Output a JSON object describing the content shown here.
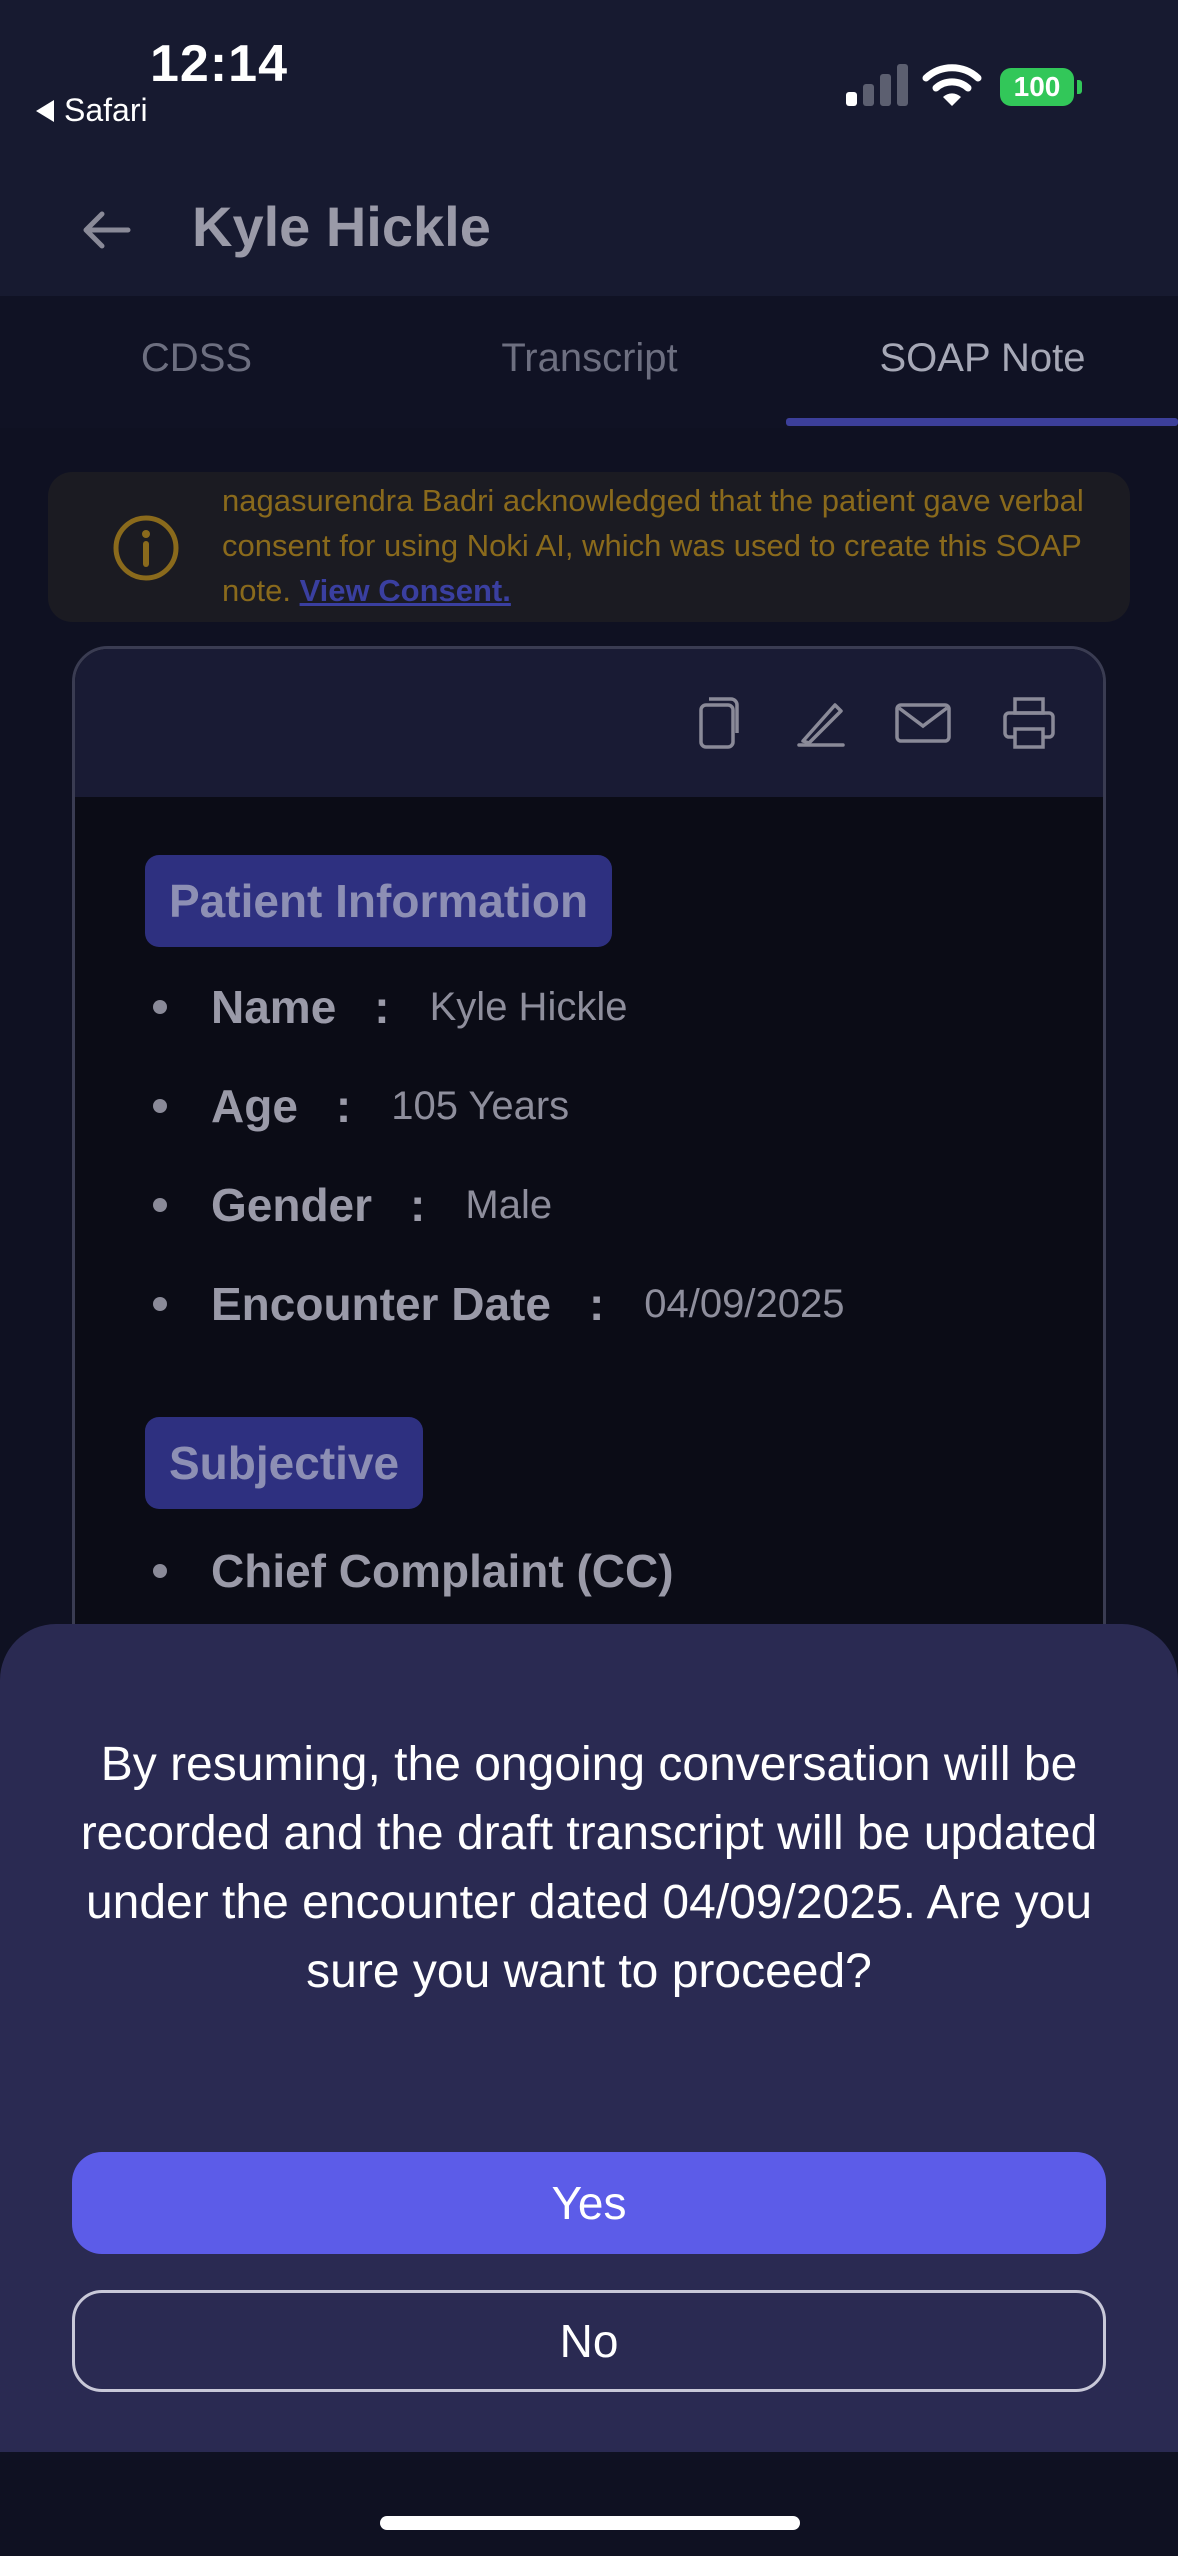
{
  "status_bar": {
    "time": "12:14",
    "back_app": "Safari",
    "battery": "100"
  },
  "header": {
    "title": "Kyle Hickle"
  },
  "tabs": [
    {
      "label": "CDSS"
    },
    {
      "label": "Transcript"
    },
    {
      "label": "SOAP Note"
    }
  ],
  "active_tab": "SOAP Note",
  "consent": {
    "text": "nagasurendra Badri acknowledged that the patient gave verbal consent for using Noki AI, which was used to create this SOAP note. ",
    "link": "View Consent."
  },
  "note": {
    "toolbar_icons": [
      "copy-icon",
      "edit-icon",
      "mail-icon",
      "print-icon"
    ],
    "patient_info": {
      "heading": "Patient Information",
      "fields": [
        {
          "label": "Name",
          "sep": ":",
          "value": "Kyle Hickle"
        },
        {
          "label": "Age",
          "sep": ":",
          "value": "105 Years"
        },
        {
          "label": "Gender",
          "sep": ":",
          "value": "Male"
        },
        {
          "label": "Encounter Date",
          "sep": ":",
          "value": "04/09/2025"
        }
      ]
    },
    "subjective": {
      "heading": "Subjective",
      "items": [
        {
          "label": "Chief Complaint (CC)"
        }
      ]
    }
  },
  "dialog": {
    "message": "By resuming, the ongoing conversation will be recorded and the draft transcript will be updated under the encounter dated 04/09/2025. Are you sure you want to proceed?",
    "yes_label": "Yes",
    "no_label": "No"
  },
  "colors": {
    "accent": "#5c5ce8",
    "sheet": "#2a2a52",
    "battery": "#32c759"
  }
}
